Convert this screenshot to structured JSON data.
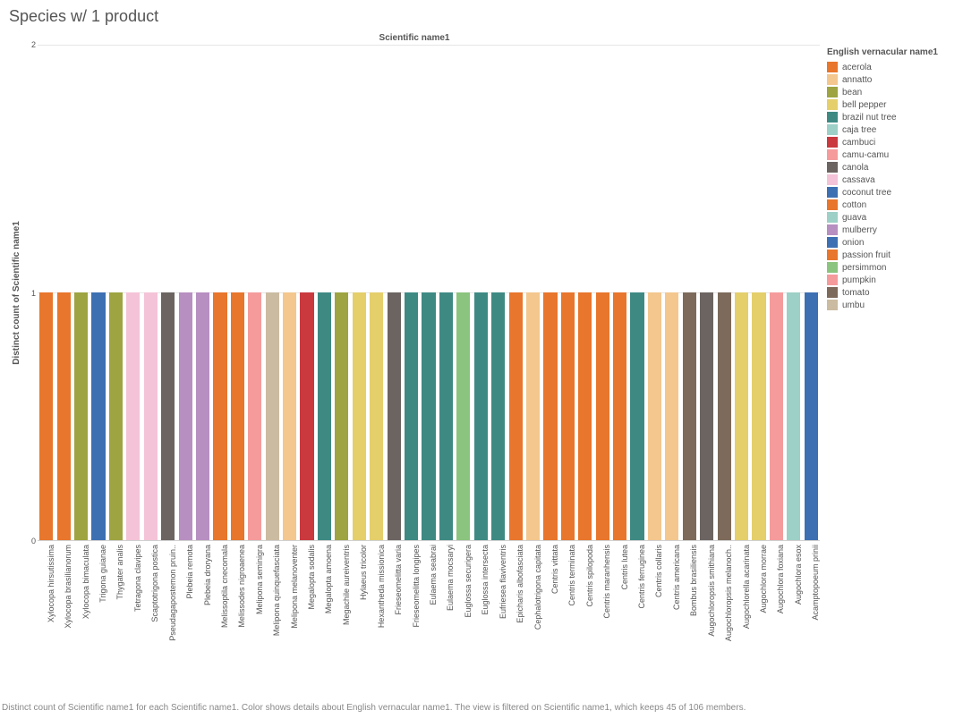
{
  "title": "Species w/ 1 product",
  "chart_title": "Scientific name1",
  "y_axis_label": "Distinct count of Scientific name1",
  "legend_title": "English vernacular name1",
  "caption": "Distinct count of Scientific name1 for each Scientific name1.  Color shows details about English vernacular name1. The view is filtered on Scientific name1, which keeps 45 of 106 members.",
  "chart_data": {
    "type": "bar",
    "ylim": [
      0,
      2
    ],
    "yticks": [
      0,
      1,
      2
    ],
    "xlabel": "",
    "ylabel": "Distinct count of Scientific name1",
    "title": "Scientific name1",
    "categories": [
      "Xylocopa hirsutissima",
      "Xylocopa brasilianorum",
      "Xylocopa bimaculata",
      "Trigona guianae",
      "Thygater analis",
      "Tetragona clavipes",
      "Scaptotrigona postica",
      "Pseudagapostemon pruin..",
      "Plebeia remota",
      "Plebeia droryana",
      "Melissoptila cnecomala",
      "Melissodes nigroaenea",
      "Melipona seminigra",
      "Melipona quinquefasciata",
      "Melipona melanoventer",
      "Megalopta sodalis",
      "Megalopta amoena",
      "Megachile aureiventris",
      "Hylaeus tricolor",
      "Hexantheda missionica",
      "Frieseomelitta varia",
      "Frieseomelitta longipes",
      "Eulaema seabrai",
      "Eulaema mocsaryi",
      "Euglossa securigera",
      "Euglossa intersecta",
      "Eufriesea flaviventris",
      "Epicharis albofasciata",
      "Cephalotrigona capitata",
      "Centris vittata",
      "Centris terminata",
      "Centris spilopoda",
      "Centris maranhensis",
      "Centris lutea",
      "Centris ferruginea",
      "Centris collaris",
      "Centris americana",
      "Bombus brasiliensis",
      "Augochloropsis smithiana",
      "Augochloropsis melanoch..",
      "Augochlorella acarinata",
      "Augochlora morrae",
      "Augochlora foxiana",
      "Augochlora esox",
      "Acamptopoeum prinii"
    ],
    "values": [
      1,
      1,
      1,
      1,
      1,
      1,
      1,
      1,
      1,
      1,
      1,
      1,
      1,
      1,
      1,
      1,
      1,
      1,
      1,
      1,
      1,
      1,
      1,
      1,
      1,
      1,
      1,
      1,
      1,
      1,
      1,
      1,
      1,
      1,
      1,
      1,
      1,
      1,
      1,
      1,
      1,
      1,
      1,
      1,
      1
    ],
    "series_colors": [
      "passion fruit",
      "passion fruit",
      "bean",
      "coconut tree",
      "bean",
      "cassava",
      "cassava",
      "canola",
      "mulberry",
      "mulberry",
      "cotton",
      "cotton",
      "camu-camu",
      "umbu",
      "annatto",
      "cambuci",
      "brazil nut tree",
      "bean",
      "bell pepper",
      "bell pepper",
      "canola",
      "brazil nut tree",
      "brazil nut tree",
      "brazil nut tree",
      "persimmon",
      "brazil nut tree",
      "brazil nut tree",
      "acerola",
      "annatto",
      "acerola",
      "acerola",
      "acerola",
      "acerola",
      "acerola",
      "brazil nut tree",
      "annatto",
      "annatto",
      "tomato",
      "canola",
      "tomato",
      "bell pepper",
      "bell pepper",
      "pumpkin",
      "guava",
      "onion"
    ],
    "legend": [
      {
        "name": "acerola",
        "color": "#e8762c"
      },
      {
        "name": "annatto",
        "color": "#f3c78e"
      },
      {
        "name": "bean",
        "color": "#9da441"
      },
      {
        "name": "bell pepper",
        "color": "#e4cf6b"
      },
      {
        "name": "brazil nut tree",
        "color": "#3e8a83"
      },
      {
        "name": "caja tree",
        "color": "#9dd0c6"
      },
      {
        "name": "cambuci",
        "color": "#c9393e"
      },
      {
        "name": "camu-camu",
        "color": "#f59b9c"
      },
      {
        "name": "canola",
        "color": "#6b6460"
      },
      {
        "name": "cassava",
        "color": "#f4c3d7"
      },
      {
        "name": "coconut tree",
        "color": "#3d70b2"
      },
      {
        "name": "cotton",
        "color": "#e8762c"
      },
      {
        "name": "guava",
        "color": "#9dd0c6"
      },
      {
        "name": "mulberry",
        "color": "#b78fc1"
      },
      {
        "name": "onion",
        "color": "#3d70b2"
      },
      {
        "name": "passion fruit",
        "color": "#e8762c"
      },
      {
        "name": "persimmon",
        "color": "#8bc47e"
      },
      {
        "name": "pumpkin",
        "color": "#f59b9c"
      },
      {
        "name": "tomato",
        "color": "#7d6a5a"
      },
      {
        "name": "umbu",
        "color": "#cbbba1"
      }
    ]
  }
}
